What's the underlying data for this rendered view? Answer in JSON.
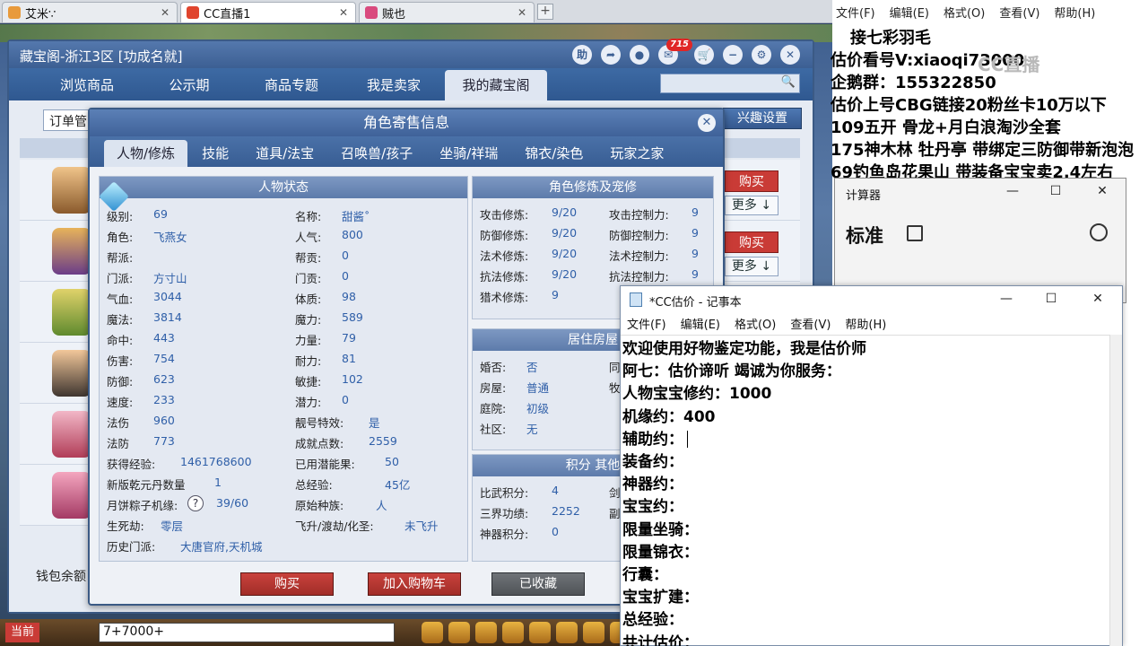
{
  "browser": {
    "tabs": [
      {
        "label": "艾米∵",
        "active": false
      },
      {
        "label": "CC直播1",
        "active": true
      },
      {
        "label": "贼也",
        "active": false
      }
    ],
    "new_tab": "+"
  },
  "cbg": {
    "title": "藏宝阁-浙江3区 [功成名就]",
    "icon_help": "助",
    "badge": "715",
    "nav": [
      "浏览商品",
      "公示期",
      "商品专题",
      "我是卖家",
      "我的藏宝阁"
    ],
    "order_select": "订单管",
    "interest_button": "兴趣设置",
    "buy_label": "购买",
    "more_label": "更多 ↓",
    "wallet": "钱包余额"
  },
  "dialog": {
    "title": "角色寄售信息",
    "tabs": [
      "人物/修炼",
      "技能",
      "道具/法宝",
      "召唤兽/孩子",
      "坐骑/祥瑞",
      "锦衣/染色",
      "玩家之家"
    ],
    "status_title": "人物状态",
    "cultivation_title": "角色修炼及宠修",
    "house_title": "居住房屋",
    "points_title": "积分 其他",
    "status_left": [
      {
        "k": "级别:",
        "v": "69"
      },
      {
        "k": "角色:",
        "v": "飞燕女"
      },
      {
        "k": "帮派:",
        "v": ""
      },
      {
        "k": "门派:",
        "v": "方寸山"
      },
      {
        "k": "气血:",
        "v": "3044"
      },
      {
        "k": "魔法:",
        "v": "3814"
      },
      {
        "k": "命中:",
        "v": "443"
      },
      {
        "k": "伤害:",
        "v": "754"
      },
      {
        "k": "防御:",
        "v": "623"
      },
      {
        "k": "速度:",
        "v": "233"
      },
      {
        "k": "法伤",
        "v": "960"
      },
      {
        "k": "法防",
        "v": "773"
      }
    ],
    "status_right": [
      {
        "k": "名称:",
        "v": "甜酱˚"
      },
      {
        "k": "人气:",
        "v": "800"
      },
      {
        "k": "帮贡:",
        "v": "0"
      },
      {
        "k": "门贡:",
        "v": "0"
      },
      {
        "k": "体质:",
        "v": "98"
      },
      {
        "k": "魔力:",
        "v": "589"
      },
      {
        "k": "力量:",
        "v": "79"
      },
      {
        "k": "耐力:",
        "v": "81"
      },
      {
        "k": "敏捷:",
        "v": "102"
      },
      {
        "k": "潜力:",
        "v": "0"
      },
      {
        "k": "靓号特效:",
        "v": "是"
      },
      {
        "k": "成就点数:",
        "v": "2559"
      }
    ],
    "extra_left": [
      {
        "k": "获得经验:",
        "v": "1461768600"
      },
      {
        "k": "新版乾元丹数量",
        "v": "1"
      },
      {
        "k": "月饼粽子机缘:",
        "v": "39/60"
      },
      {
        "k": "生死劫:",
        "v": "零层"
      },
      {
        "k": "历史门派:",
        "v": "大唐官府,天机城"
      }
    ],
    "extra_right": [
      {
        "k": "已用潜能果:",
        "v": "50"
      },
      {
        "k": "总经验:",
        "v": "45亿"
      },
      {
        "k": "原始种族:",
        "v": "人"
      },
      {
        "k": "飞升/渡劫/化圣:",
        "v": "未飞升"
      }
    ],
    "question": "?",
    "cultivation": [
      {
        "k": "攻击修炼:",
        "v": "9/20",
        "k2": "攻击控制力:",
        "v2": "9"
      },
      {
        "k": "防御修炼:",
        "v": "9/20",
        "k2": "防御控制力:",
        "v2": "9"
      },
      {
        "k": "法术修炼:",
        "v": "9/20",
        "k2": "法术控制力:",
        "v2": "9"
      },
      {
        "k": "抗法修炼:",
        "v": "9/20",
        "k2": "抗法控制力:",
        "v2": "9"
      },
      {
        "k": "猎术修炼:",
        "v": "9",
        "k2": "",
        "v2": ""
      }
    ],
    "house": [
      {
        "k": "婚否:",
        "v": "否",
        "k2": "同"
      },
      {
        "k": "房屋:",
        "v": "普通",
        "k2": "牧"
      },
      {
        "k": "庭院:",
        "v": "初级",
        "k2": ""
      },
      {
        "k": "社区:",
        "v": "无",
        "k2": ""
      }
    ],
    "points": [
      {
        "k": "比武积分:",
        "v": "4",
        "k2": "剑"
      },
      {
        "k": "三界功绩:",
        "v": "2252",
        "k2": "副"
      },
      {
        "k": "神器积分:",
        "v": "0",
        "k2": ""
      }
    ],
    "buttons": {
      "buy": "购买",
      "cart": "加入购物车",
      "fav": "已收藏"
    }
  },
  "chat": {
    "channel": "当前",
    "input": "7+7000+"
  },
  "overlay": {
    "menu": [
      "文件(F)",
      "编辑(E)",
      "格式(O)",
      "查看(V)",
      "帮助(H)"
    ],
    "lines": [
      "接七彩羽毛",
      "估价看号V:xiaoqi73000",
      "企鹅群：155322850",
      "估价上号CBG链接20粉丝卡10万以下",
      "109五开 骨龙+月白浪淘沙全套",
      "175神木林 牡丹亭  带绑定三防御带新泡泡",
      "69钓鱼岛花果山 带装备宝宝卖2.4左右"
    ],
    "watermark": "CC直播"
  },
  "calculator": {
    "title": "计算器",
    "mode": "标准"
  },
  "notepad": {
    "title": "*CC估价 - 记事本",
    "menu": [
      "文件(F)",
      "编辑(E)",
      "格式(O)",
      "查看(V)",
      "帮助(H)"
    ],
    "lines": [
      "欢迎使用好物鉴定功能，我是估价师",
      "阿七：估价谛听 竭诚为你服务：",
      "人物宝宝修约：1000",
      "机缘约：400",
      "辅助约：",
      "装备约：",
      "神器约：",
      "宝宝约：",
      "限量坐骑：",
      "限量锦衣：",
      "行囊：",
      "宝宝扩建：",
      "总经验：",
      "共计估价："
    ]
  }
}
